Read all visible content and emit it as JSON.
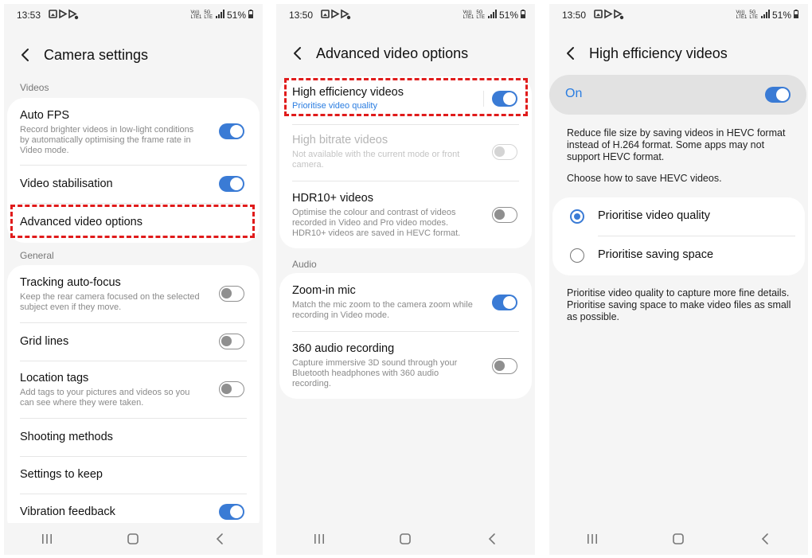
{
  "screens": [
    {
      "status": {
        "time": "13:53",
        "battery": "51%",
        "net_top": "Vo))",
        "net_bottom": "LTE1",
        "net2_top": "5G",
        "net2_bottom": "LTE"
      },
      "title": "Camera settings",
      "sections": {
        "videos": "Videos",
        "general": "General"
      },
      "items": {
        "auto_fps": {
          "title": "Auto FPS",
          "desc": "Record brighter videos in low-light conditions by automatically optimising the frame rate in Video mode.",
          "toggle": "on"
        },
        "video_stab": {
          "title": "Video stabilisation",
          "toggle": "on"
        },
        "advanced": {
          "title": "Advanced video options"
        },
        "tracking": {
          "title": "Tracking auto-focus",
          "desc": "Keep the rear camera focused on the selected subject even if they move.",
          "toggle": "off"
        },
        "grid": {
          "title": "Grid lines",
          "toggle": "off"
        },
        "location": {
          "title": "Location tags",
          "desc": "Add tags to your pictures and videos so you can see where they were taken.",
          "toggle": "off"
        },
        "shooting": {
          "title": "Shooting methods"
        },
        "keep": {
          "title": "Settings to keep"
        },
        "vibration": {
          "title": "Vibration feedback",
          "toggle": "on"
        }
      }
    },
    {
      "status": {
        "time": "13:50",
        "battery": "51%",
        "net_top": "Vo))",
        "net_bottom": "LTE1",
        "net2_top": "5G",
        "net2_bottom": "LTE"
      },
      "title": "Advanced video options",
      "sections": {
        "audio": "Audio"
      },
      "items": {
        "hev": {
          "title": "High efficiency videos",
          "sub": "Prioritise video quality",
          "toggle": "on"
        },
        "bitrate": {
          "title": "High bitrate videos",
          "desc": "Not available with the current mode or front camera.",
          "toggle": "disabled"
        },
        "hdr": {
          "title": "HDR10+ videos",
          "desc": "Optimise the colour and contrast of videos recorded in Video and Pro video modes. HDR10+ videos are saved in HEVC format.",
          "toggle": "off"
        },
        "zoom_mic": {
          "title": "Zoom-in mic",
          "desc": "Match the mic zoom to the camera zoom while recording in Video mode.",
          "toggle": "on"
        },
        "audio360": {
          "title": "360 audio recording",
          "desc": "Capture immersive 3D sound through your Bluetooth headphones with 360 audio recording.",
          "toggle": "off"
        }
      }
    },
    {
      "status": {
        "time": "13:50",
        "battery": "51%",
        "net_top": "Vo))",
        "net_bottom": "LTE1",
        "net2_top": "5G",
        "net2_bottom": "LTE"
      },
      "title": "High efficiency videos",
      "on_label": "On",
      "description": "Reduce file size by saving videos in HEVC format instead of H.264 format. Some apps may not support HEVC format.",
      "choose": "Choose how to save HEVC videos.",
      "options": [
        {
          "label": "Prioritise video quality",
          "selected": true
        },
        {
          "label": "Prioritise saving space",
          "selected": false
        }
      ],
      "footer": "Prioritise video quality to capture more fine details. Prioritise saving space to make video files as small as possible."
    }
  ],
  "colors": {
    "accent": "#3a7bd5",
    "highlight_box": "#e01b1b",
    "background": "#f5f5f5",
    "card": "#ffffff"
  }
}
